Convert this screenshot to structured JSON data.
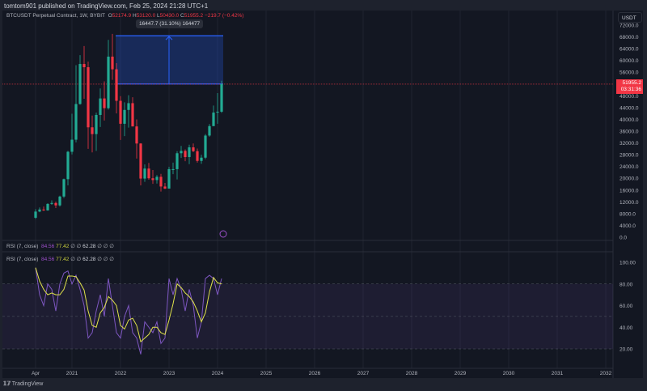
{
  "header": {
    "published": "tomtom901 published on TradingView.com, Feb 25, 2024 21:28 UTC+1"
  },
  "symbol": {
    "title": "BTCUSDT Perpetual Contract, 1W, BYBIT",
    "o_label": "O",
    "o": "52174.9",
    "h_label": "H",
    "h": "53120.0",
    "l_label": "L",
    "l": "50430.0",
    "c_label": "C",
    "c": "51955.2",
    "change": "−219.7 (−0.42%)"
  },
  "currency": "USDT",
  "last_price": {
    "price": "51955.2",
    "countdown": "03:31:36"
  },
  "measure": {
    "label": "16447.7 (31.10%) 164477"
  },
  "colors": {
    "up": "#22ab94",
    "down": "#f23645",
    "rsi": "#7e57c2",
    "rsi_ma": "#e0e34a",
    "measure": "#2962ff"
  },
  "price_axis": [
    "72000.0",
    "68000.0",
    "64000.0",
    "60000.0",
    "56000.0",
    "48000.0",
    "44000.0",
    "40000.0",
    "36000.0",
    "32000.0",
    "28000.0",
    "24000.0",
    "20000.0",
    "16000.0",
    "12000.0",
    "8000.0",
    "4000.0",
    "0.0"
  ],
  "rsi_legend": [
    {
      "name": "RSI (7, close)",
      "v1": "84.56",
      "v2": "77.42",
      "na1": "∅",
      "na2": "∅",
      "v3": "62.28",
      "na3": "∅",
      "na4": "∅",
      "na5": "∅"
    },
    {
      "name": "RSI (7, close)",
      "v1": "84.56",
      "v2": "77.42",
      "na1": "∅",
      "na2": "∅",
      "v3": "62.28",
      "na3": "∅",
      "na4": "∅",
      "na5": "∅"
    }
  ],
  "rsi_axis": [
    "100.00",
    "80.00",
    "60.00",
    "40.00",
    "20.00"
  ],
  "time_axis": [
    "Apr",
    "2021",
    "2022",
    "2023",
    "2024",
    "2025",
    "2026",
    "2027",
    "2028",
    "2029",
    "2030",
    "2031",
    "2032"
  ],
  "footer": {
    "brand": "TradingView"
  },
  "chart_data": {
    "type": "candlestick",
    "interval": "monthly approximation",
    "start": "2020-04",
    "close": [
      8.7,
      9.4,
      9.1,
      11.3,
      11.6,
      10.8,
      13.8,
      19.7,
      29.0,
      33.1,
      45.2,
      58.8,
      57.7,
      37.3,
      35.0,
      41.5,
      47.1,
      43.8,
      61.3,
      57.0,
      46.3,
      38.5,
      43.2,
      45.5,
      37.6,
      31.8,
      19.9,
      23.3,
      20.0,
      19.4,
      20.5,
      17.2,
      16.5,
      23.1,
      23.1,
      28.5,
      29.3,
      27.2,
      30.5,
      29.2,
      25.9,
      27.0,
      34.5,
      37.7,
      42.3,
      42.6,
      51.96
    ],
    "high": [
      9.5,
      10.1,
      10.4,
      11.5,
      12.5,
      12.1,
      14.1,
      19.9,
      29.3,
      41.9,
      58.4,
      61.8,
      64.9,
      59.6,
      41.3,
      42.3,
      50.5,
      52.9,
      67.0,
      69.0,
      59.1,
      47.9,
      45.8,
      48.2,
      47.5,
      40.0,
      31.9,
      24.7,
      25.2,
      22.8,
      21.1,
      21.5,
      18.4,
      23.9,
      25.3,
      29.2,
      31.0,
      29.8,
      31.4,
      31.8,
      30.1,
      28.0,
      35.0,
      38.4,
      44.7,
      48.9,
      53.1
    ],
    "low": [
      6.2,
      8.5,
      8.9,
      9.0,
      11.0,
      9.9,
      10.4,
      13.3,
      17.6,
      28.1,
      32.2,
      45.0,
      47.0,
      30.0,
      28.8,
      29.3,
      37.4,
      39.6,
      43.3,
      53.4,
      42.0,
      33.0,
      34.3,
      37.2,
      37.6,
      26.7,
      17.6,
      18.8,
      19.5,
      18.1,
      18.2,
      15.5,
      16.3,
      16.5,
      21.4,
      19.6,
      26.9,
      25.8,
      24.8,
      28.9,
      25.3,
      24.9,
      26.5,
      34.1,
      40.2,
      38.5,
      42.2
    ],
    "rsi": [
      95,
      70,
      60,
      80,
      75,
      55,
      80,
      90,
      92,
      80,
      88,
      75,
      60,
      30,
      35,
      55,
      70,
      50,
      85,
      60,
      35,
      30,
      50,
      60,
      35,
      30,
      15,
      45,
      40,
      35,
      45,
      25,
      30,
      85,
      70,
      85,
      75,
      55,
      75,
      60,
      30,
      45,
      85,
      88,
      85,
      70,
      85
    ],
    "price_unit": "thousand USDT",
    "ylim": [
      0,
      72000
    ],
    "rsi_ylim": [
      0,
      100
    ],
    "rsi_levels": [
      80,
      50,
      20
    ]
  }
}
